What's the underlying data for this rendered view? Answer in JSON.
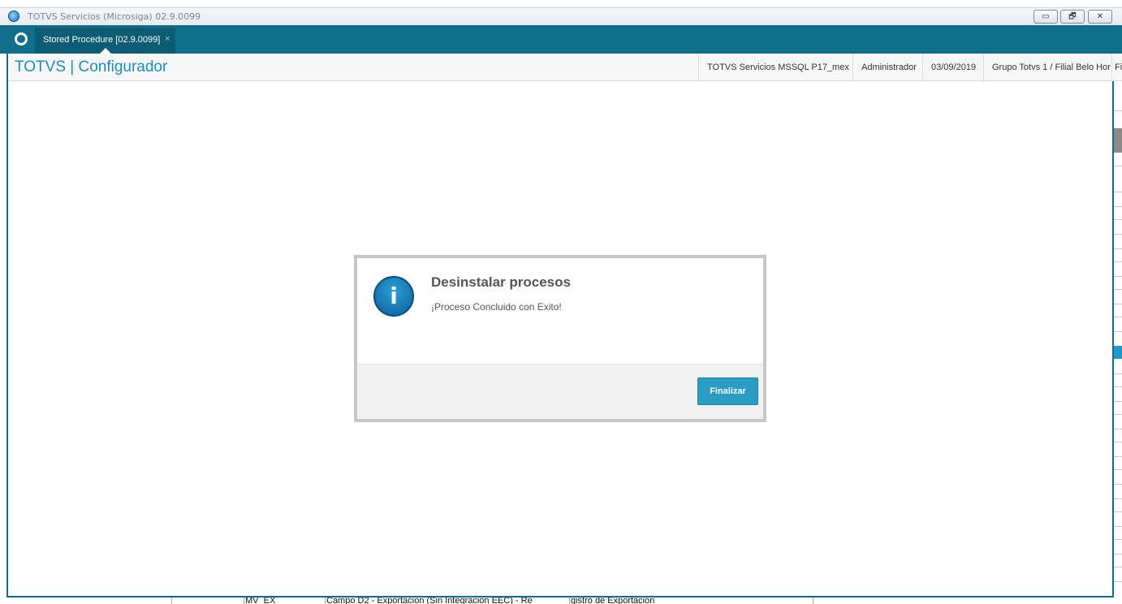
{
  "window": {
    "title": "TOTVS Servicios (Microsiga) 02.9.0099",
    "minimize_glyph": "▭",
    "restore_glyph": "🗗",
    "close_glyph": "✕"
  },
  "tabs": [
    {
      "label": "Stored Procedure [02.9.0099]",
      "close": "×",
      "active": true
    }
  ],
  "header": {
    "app_title": "TOTVS | Configurador",
    "environment": "TOTVS Servicios MSSQL P17_mex",
    "user": "Administrador",
    "date": "03/09/2019",
    "branch": "Grupo Totvs 1 / Filial Belo Hor",
    "extra": "Fil"
  },
  "dialog": {
    "icon": "info-icon",
    "icon_glyph": "i",
    "title": "Desinstalar procesos",
    "message": "¡Proceso Concluido con Exito!",
    "finish_label": "Finalizar"
  },
  "background_row": {
    "col1": "MV_EX",
    "col2": "Campo D2 - Exportacion (Sin Integracion EEC) - Re",
    "col3": "gistro de Exportacion"
  },
  "colors": {
    "brand": "#0f6f8a",
    "accent": "#1a8fb8",
    "button": "#2a9dc4"
  }
}
